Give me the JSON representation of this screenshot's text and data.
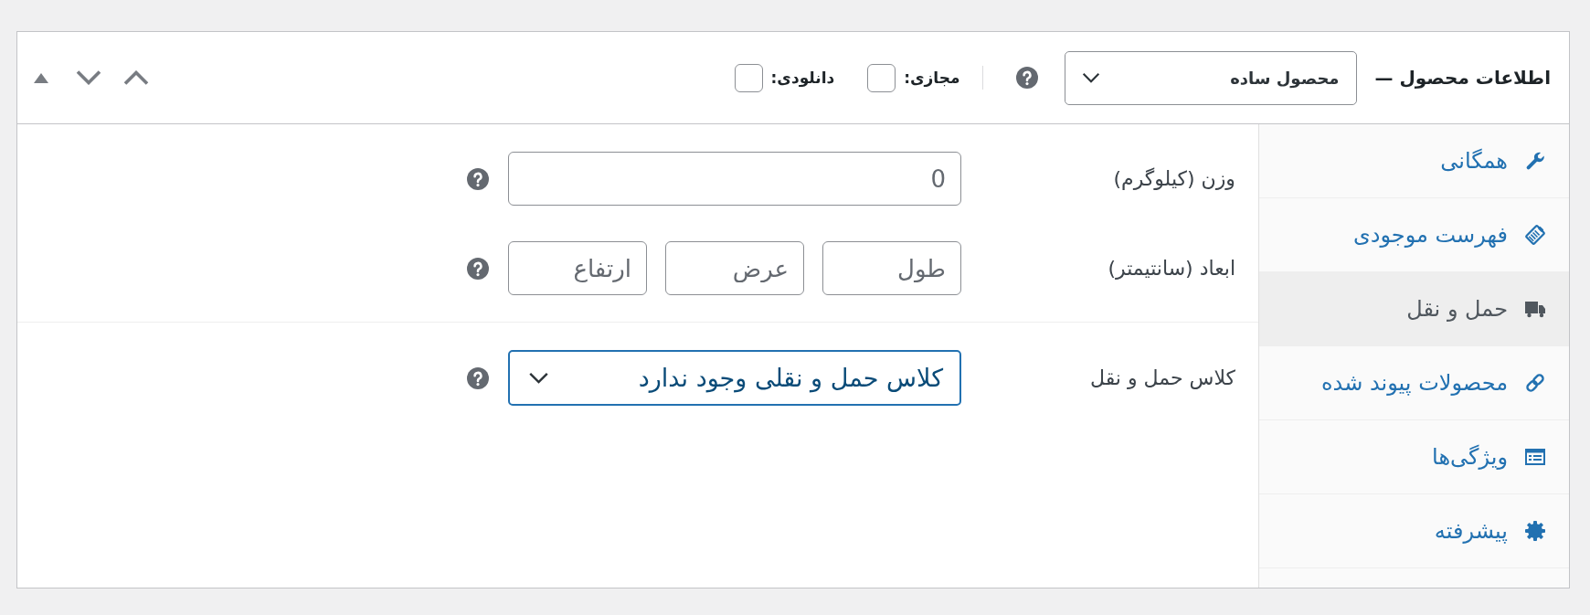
{
  "header": {
    "title": "اطلاعات محصول —",
    "product_type": {
      "value": "محصول ساده"
    },
    "options": [
      {
        "label": "مجازی:",
        "checked": false
      },
      {
        "label": "دانلودی:",
        "checked": false
      }
    ]
  },
  "tabs": [
    {
      "label": "همگانی",
      "selected": false
    },
    {
      "label": "فهرست موجودی",
      "selected": false
    },
    {
      "label": "حمل و نقل",
      "selected": true
    },
    {
      "label": "محصولات پیوند شده",
      "selected": false
    },
    {
      "label": "ویژگی‌ها",
      "selected": false
    },
    {
      "label": "پیشرفته",
      "selected": false
    }
  ],
  "shipping": {
    "sections": [
      {
        "rows": [
          {
            "label": "وزن (کیلوگرم)",
            "kind": "inputs",
            "fields": [
              {
                "placeholder": "0"
              }
            ]
          },
          {
            "label": "ابعاد (سانتیمتر)",
            "kind": "inputs",
            "fields": [
              {
                "placeholder": "طول"
              },
              {
                "placeholder": "عرض"
              },
              {
                "placeholder": "ارتفاع"
              }
            ]
          }
        ]
      },
      {
        "rows": [
          {
            "label": "کلاس حمل و نقل",
            "kind": "select",
            "value": "کلاس حمل و نقلی وجود ندارد",
            "focused": true
          }
        ]
      }
    ]
  }
}
